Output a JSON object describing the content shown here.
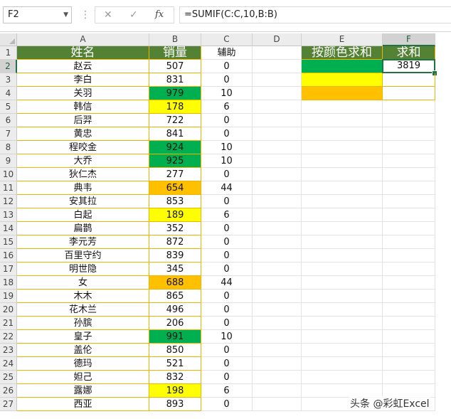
{
  "formula_bar": {
    "name_box": "F2",
    "cancel_symbol": "✕",
    "enter_symbol": "✓",
    "fx_label": "fx",
    "formula": "=SUMIF(C:C,10,B:B)"
  },
  "columns": [
    "A",
    "B",
    "C",
    "D",
    "E",
    "F"
  ],
  "selected_column": "F",
  "selected_row": 2,
  "headers": {
    "name": "姓名",
    "sales": "销量",
    "helper": "辅助",
    "sum_by_color": "按颜色求和",
    "sum": "求和"
  },
  "rows": [
    {
      "name": "赵云",
      "sales": 507,
      "helper": 0,
      "fill": ""
    },
    {
      "name": "李白",
      "sales": 831,
      "helper": 0,
      "fill": ""
    },
    {
      "name": "关羽",
      "sales": 979,
      "helper": 10,
      "fill": "green"
    },
    {
      "name": "韩信",
      "sales": 178,
      "helper": 6,
      "fill": "yellow"
    },
    {
      "name": "后羿",
      "sales": 722,
      "helper": 0,
      "fill": ""
    },
    {
      "name": "黄忠",
      "sales": 841,
      "helper": 0,
      "fill": ""
    },
    {
      "name": "程咬金",
      "sales": 924,
      "helper": 10,
      "fill": "green"
    },
    {
      "name": "大乔",
      "sales": 925,
      "helper": 10,
      "fill": "green"
    },
    {
      "name": "狄仁杰",
      "sales": 277,
      "helper": 0,
      "fill": ""
    },
    {
      "name": "典韦",
      "sales": 654,
      "helper": 44,
      "fill": "orange"
    },
    {
      "name": "安其拉",
      "sales": 853,
      "helper": 0,
      "fill": ""
    },
    {
      "name": "白起",
      "sales": 189,
      "helper": 6,
      "fill": "yellow"
    },
    {
      "name": "扁鹊",
      "sales": 352,
      "helper": 0,
      "fill": ""
    },
    {
      "name": "李元芳",
      "sales": 872,
      "helper": 0,
      "fill": ""
    },
    {
      "name": "百里守约",
      "sales": 839,
      "helper": 0,
      "fill": ""
    },
    {
      "name": "明世隐",
      "sales": 345,
      "helper": 0,
      "fill": ""
    },
    {
      "name": "女",
      "sales": 688,
      "helper": 44,
      "fill": "orange"
    },
    {
      "name": "木木",
      "sales": 865,
      "helper": 0,
      "fill": ""
    },
    {
      "name": "花木兰",
      "sales": 496,
      "helper": 0,
      "fill": ""
    },
    {
      "name": "孙膑",
      "sales": 206,
      "helper": 0,
      "fill": ""
    },
    {
      "name": "皇子",
      "sales": 991,
      "helper": 10,
      "fill": "green"
    },
    {
      "name": "盖伦",
      "sales": 850,
      "helper": 0,
      "fill": ""
    },
    {
      "name": "德玛",
      "sales": 521,
      "helper": 0,
      "fill": ""
    },
    {
      "name": "妲己",
      "sales": 832,
      "helper": 0,
      "fill": ""
    },
    {
      "name": "露娜",
      "sales": 198,
      "helper": 6,
      "fill": "yellow"
    },
    {
      "name": "西亚",
      "sales": 893,
      "helper": 0,
      "fill": ""
    }
  ],
  "color_sum_rows": [
    {
      "fill": "green",
      "sum": "3819"
    },
    {
      "fill": "yellow",
      "sum": ""
    },
    {
      "fill": "orange",
      "sum": ""
    }
  ],
  "colors": {
    "green": "#00b050",
    "yellow": "#ffff00",
    "orange": "#ffc000",
    "header_green": "#548235",
    "table_border": "#f0b400",
    "selection": "#217346"
  },
  "watermark": "头条 @彩虹Excel"
}
